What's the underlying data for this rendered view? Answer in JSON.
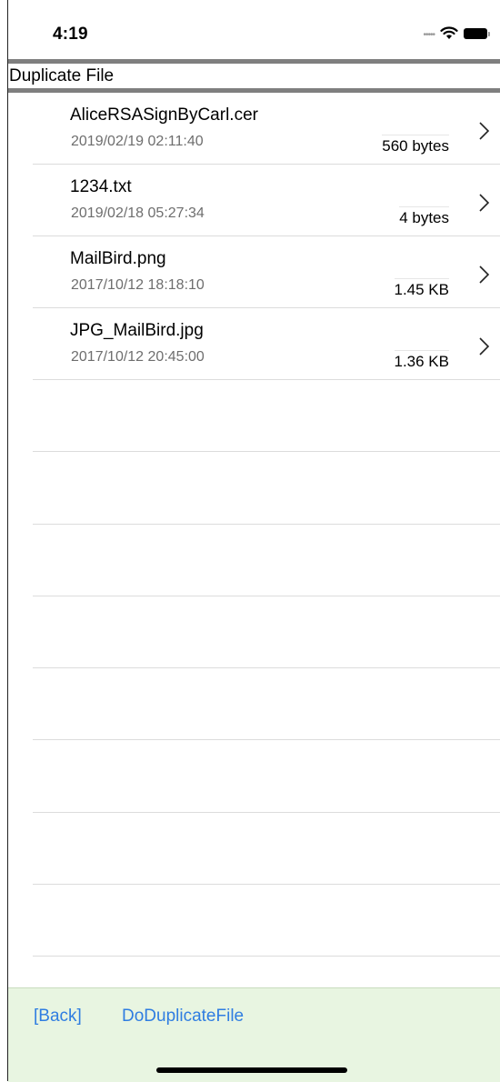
{
  "status_bar": {
    "time": "4:19",
    "signal_icon": "cellular-dots-icon",
    "wifi_icon": "wifi-icon",
    "battery_icon": "battery-icon"
  },
  "header": {
    "title": "Duplicate File"
  },
  "files": [
    {
      "name": "AliceRSASignByCarl.cer",
      "date": "2019/02/19  02:11:40",
      "size": "560 bytes"
    },
    {
      "name": "1234.txt",
      "date": "2019/02/18  05:27:34",
      "size": "4 bytes"
    },
    {
      "name": "MailBird.png",
      "date": "2017/10/12  18:18:10",
      "size": "1.45 KB"
    },
    {
      "name": "JPG_MailBird.jpg",
      "date": "2017/10/12  20:45:00",
      "size": "1.36 KB"
    }
  ],
  "toolbar": {
    "back_label": "[Back]",
    "duplicate_label": "DoDuplicateFile"
  },
  "colors": {
    "link": "#2f7de1",
    "toolbar_bg": "#e8f5e1",
    "header_bar": "#7f7f7f"
  }
}
